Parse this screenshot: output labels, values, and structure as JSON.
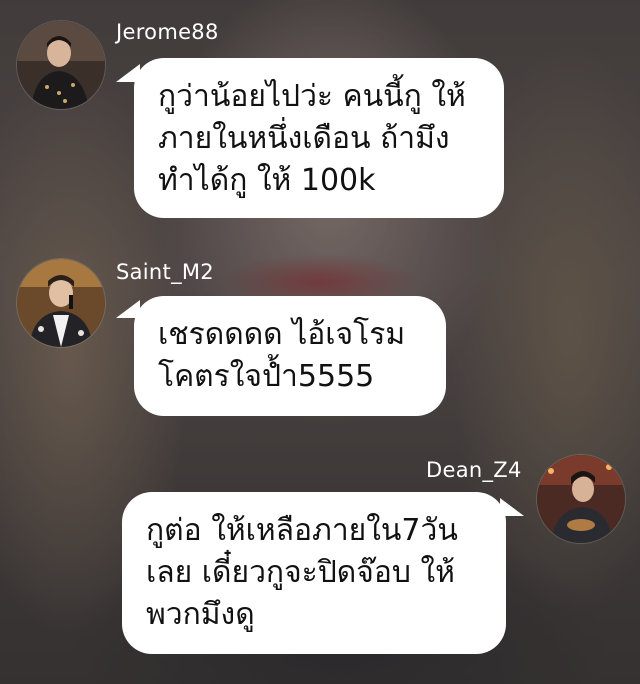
{
  "messages": [
    {
      "username": "Jerome88",
      "text": "กูว่าน้อยไปว่ะ คนนี้กู ให้\nภายในหนึ่งเดือน ถ้ามึง\nทำได้กู ให้ 100k",
      "avatar_icon": "user-avatar-photo"
    },
    {
      "username": "Saint_M2",
      "text": "เชรดดดด ไอ้เจโรม\nโคตรใจป้ำ5555",
      "avatar_icon": "user-avatar-photo"
    },
    {
      "username": "Dean_Z4",
      "text": "กูต่อ ให้เหลือภายใน7วัน\nเลย เดี๋ยวกูจะปิดจ๊อบ ให้\nพวกมึงดู",
      "avatar_icon": "user-avatar-photo"
    }
  ],
  "colors": {
    "bubble": "#ffffff",
    "username_text": "#ffffff",
    "message_text": "#111111"
  }
}
